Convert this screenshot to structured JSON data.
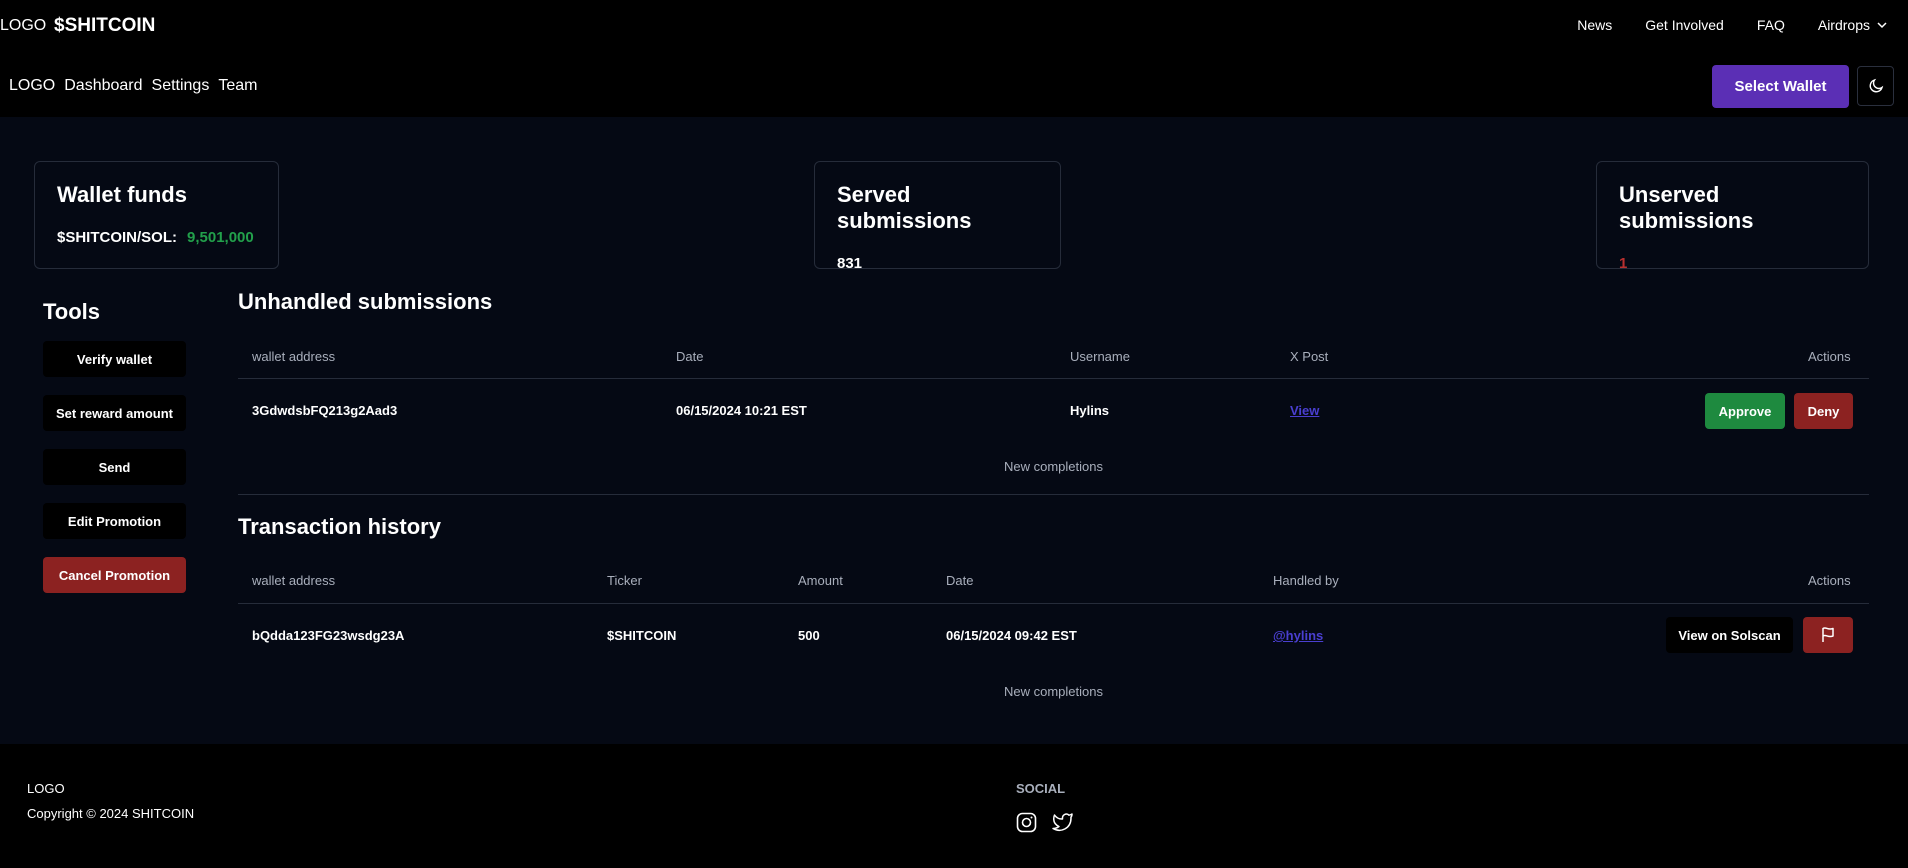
{
  "topbar": {
    "logo": "LOGO",
    "brand": "$SHITCOIN",
    "nav": [
      "News",
      "Get Involved",
      "FAQ",
      "Airdrops"
    ]
  },
  "subbar": {
    "nav": [
      "LOGO",
      "Dashboard",
      "Settings",
      "Team"
    ],
    "select_wallet": "Select Wallet"
  },
  "cards": {
    "wallet_funds": {
      "title": "Wallet funds",
      "label": "$SHITCOIN/SOL:",
      "value": "9,501,000"
    },
    "served": {
      "title": "Served submissions",
      "value": "831"
    },
    "unserved": {
      "title": "Unserved submissions",
      "value": "1"
    }
  },
  "tools": {
    "title": "Tools",
    "buttons": [
      "Verify wallet",
      "Set reward amount",
      "Send",
      "Edit Promotion",
      "Cancel Promotion"
    ]
  },
  "unhandled": {
    "title": "Unhandled submissions",
    "headers": [
      "wallet address",
      "Date",
      "Username",
      "X Post",
      "Actions"
    ],
    "rows": [
      {
        "wallet": "3GdwdsbFQ213g2Aad3",
        "date": "06/15/2024 10:21 EST",
        "username": "Hylins",
        "xpost": "View",
        "approve": "Approve",
        "deny": "Deny"
      }
    ],
    "footer": "New completions"
  },
  "history": {
    "title": "Transaction history",
    "headers": [
      "wallet address",
      "Ticker",
      "Amount",
      "Date",
      "Handled by",
      "Actions"
    ],
    "rows": [
      {
        "wallet": "bQdda123FG23wsdg23A",
        "ticker": "$SHITCOIN",
        "amount": "500",
        "date": "06/15/2024 09:42 EST",
        "handled_by": "@hylins",
        "solscan": "View on Solscan"
      }
    ],
    "footer": "New completions"
  },
  "footer": {
    "logo": "LOGO",
    "copyright": "Copyright © 2024 SHITCOIN",
    "social": "SOCIAL"
  },
  "colors": {
    "accent": "#5b2fb5",
    "approve": "#1e8a3f",
    "deny": "#8c2221",
    "positive": "#22a04b",
    "negative": "#b8302f"
  }
}
